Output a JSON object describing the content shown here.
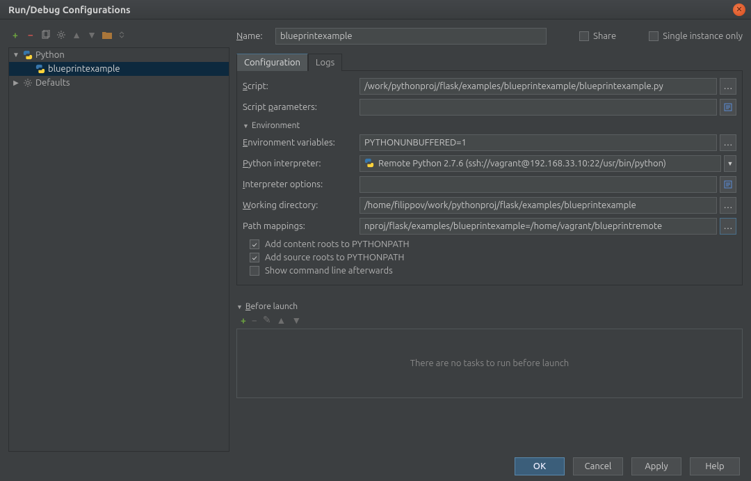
{
  "window": {
    "title": "Run/Debug Configurations"
  },
  "tree": {
    "root": "Python",
    "child": "blueprintexample",
    "defaults": "Defaults"
  },
  "form": {
    "name_label_pre": "N",
    "name_label_rest": "ame:",
    "name_value": "blueprintexample",
    "share_label": "Share",
    "single_label": "Single instance only",
    "tabs": {
      "config": "Configuration",
      "logs": "Logs"
    },
    "script_pre": "S",
    "script_rest": "cript:",
    "script_value": "/work/pythonproj/flask/examples/blueprintexample/blueprintexample.py",
    "params_label": "Script parameters:",
    "params_ul": "p",
    "environment_hdr": "Environment",
    "env_vars_pre": "E",
    "env_vars_rest": "nvironment variables:",
    "env_vars_value": "PYTHONUNBUFFERED=1",
    "py_interp_pre": "P",
    "py_interp_rest": "ython interpreter:",
    "py_interp_value": "Remote Python 2.7.6 (ssh://vagrant@192.168.33.10:22/usr/bin/python)",
    "interp_opts_pre": "I",
    "interp_opts_rest": "nterpreter options:",
    "workdir_pre": "W",
    "workdir_rest": "orking directory:",
    "workdir_value": "/home/filippov/work/pythonproj/flask/examples/blueprintexample",
    "pathmap_label": "Path mappings:",
    "pathmap_value": "nproj/flask/examples/blueprintexample=/home/vagrant/blueprintremote",
    "add_content": "Add content roots to PYTHONPATH",
    "add_source": "Add source roots to PYTHONPATH",
    "show_cmd": "Show command line afterwards",
    "before_pre": "B",
    "before_rest": "efore launch",
    "before_empty": "There are no tasks to run before launch"
  },
  "footer": {
    "ok": "OK",
    "cancel": "Cancel",
    "apply": "Apply",
    "help": "Help"
  }
}
